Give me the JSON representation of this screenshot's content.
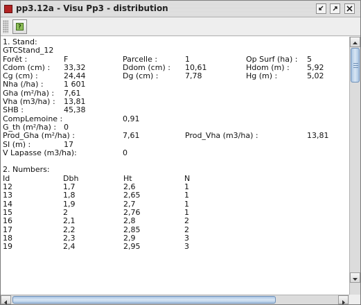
{
  "window": {
    "title": "pp3.12a - Visu Pp3 - distribution",
    "icons": [
      "app-icon",
      "minimize-icon",
      "maximize-icon",
      "close-icon"
    ]
  },
  "toolbar": {
    "help_icon": "help-icon"
  },
  "stand": {
    "heading": "1. Stand:",
    "name": "GTCStand_12",
    "rows": [
      [
        "Forêt :",
        "F",
        "Parcelle :",
        "1",
        "Op Surf (ha) :",
        "5"
      ],
      [
        "Cdom (cm) :",
        "33,32",
        "Ddom (cm) :",
        "10,61",
        "Hdom (m) :",
        "5,92"
      ],
      [
        "Cg (cm) :",
        "24,44",
        "Dg (cm) :",
        "7,78",
        "Hg (m) :",
        "5,02"
      ],
      [
        "Nha (/ha) :",
        "1 601",
        "",
        "",
        "",
        ""
      ],
      [
        "Gha (m²/ha) :",
        "7,61",
        "",
        "",
        "",
        ""
      ],
      [
        "Vha (m3/ha) :",
        "13,81",
        "",
        "",
        "",
        ""
      ],
      [
        "SHB :",
        "45,38",
        "",
        "",
        "",
        ""
      ],
      [
        "CompLemoine :",
        "",
        "0,91",
        "",
        "",
        ""
      ],
      [
        "G_th (m²/ha) :",
        "0",
        "",
        "",
        "",
        ""
      ],
      [
        "Prod_Gha (m²/ha) :",
        "",
        "7,61",
        "Prod_Vha (m3/ha) :",
        "",
        "13,81"
      ],
      [
        "SI (m) :",
        "17",
        "",
        "",
        "",
        ""
      ],
      [
        "V Lapasse (m3/ha):",
        "",
        "0",
        "",
        "",
        ""
      ]
    ]
  },
  "numbers": {
    "heading": "2. Numbers:",
    "columns": [
      "Id",
      "Dbh",
      "Ht",
      "N"
    ],
    "rows": [
      [
        "12",
        "1,7",
        "2,6",
        "1"
      ],
      [
        "13",
        "1,8",
        "2,65",
        "1"
      ],
      [
        "14",
        "1,9",
        "2,7",
        "1"
      ],
      [
        "15",
        "2",
        "2,76",
        "1"
      ],
      [
        "16",
        "2,1",
        "2,8",
        "2"
      ],
      [
        "17",
        "2,2",
        "2,85",
        "2"
      ],
      [
        "18",
        "2,3",
        "2,9",
        "3"
      ],
      [
        "19",
        "2,4",
        "2,95",
        "3"
      ]
    ]
  }
}
